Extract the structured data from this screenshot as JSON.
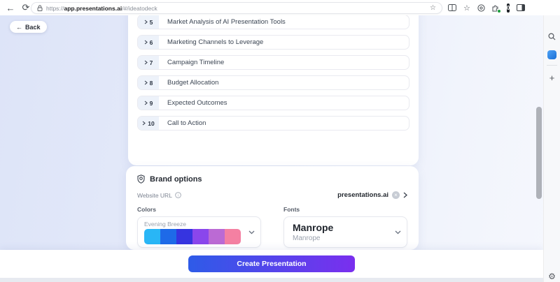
{
  "browser": {
    "url_scheme": "https://",
    "url_host": "app.presentations.ai",
    "url_path": "/#/ideatodeck",
    "extension_badge": "0"
  },
  "page": {
    "back_label": "Back",
    "outline": {
      "items": [
        {
          "number": "5",
          "title": "Market Analysis of AI Presentation Tools"
        },
        {
          "number": "6",
          "title": "Marketing Channels to Leverage"
        },
        {
          "number": "7",
          "title": "Campaign Timeline"
        },
        {
          "number": "8",
          "title": "Budget Allocation"
        },
        {
          "number": "9",
          "title": "Expected Outcomes"
        },
        {
          "number": "10",
          "title": "Call to Action"
        }
      ]
    },
    "brand": {
      "title": "Brand options",
      "website_label": "Website URL",
      "website_value": "presentations.ai",
      "colors_label": "Colors",
      "palette_name": "Evening Breeze",
      "palette_colors": [
        "#29b6f6",
        "#1e6ae8",
        "#3634e0",
        "#8a46ec",
        "#bb6ad4",
        "#f480a2"
      ],
      "fonts_label": "Fonts",
      "font_name": "Manrope",
      "font_preview": "Manrope"
    },
    "create_button_label": "Create Presentation",
    "accent_gradient": {
      "from": "#2e5be8",
      "to": "#7a2fee"
    }
  }
}
